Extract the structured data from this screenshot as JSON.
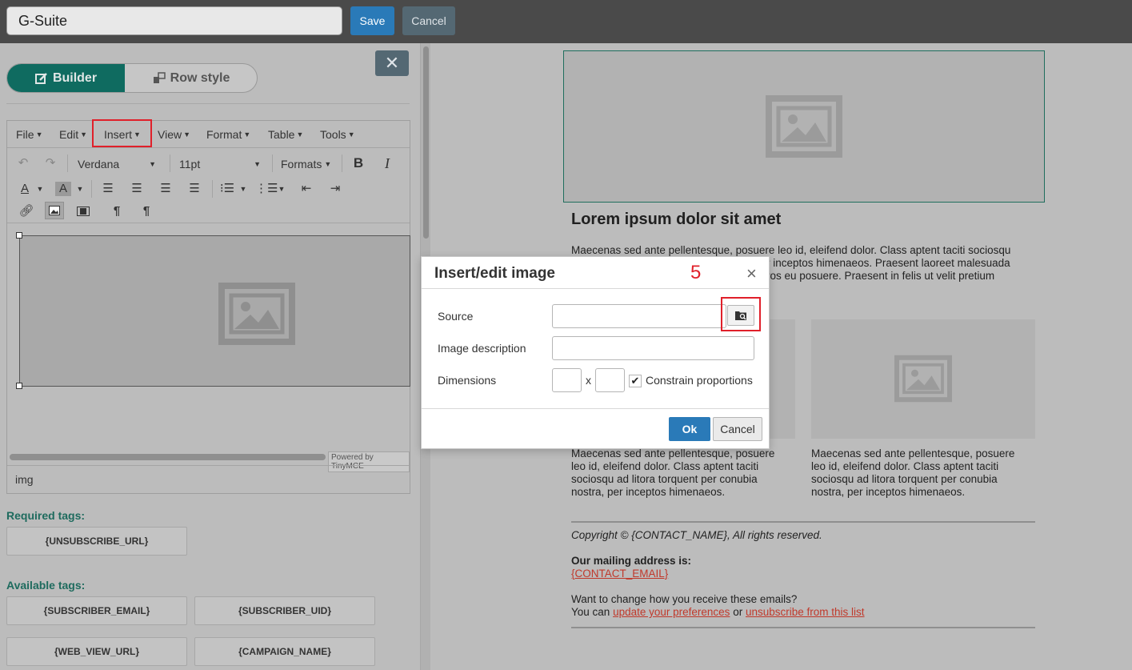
{
  "header": {
    "title_value": "G-Suite",
    "save_label": "Save",
    "cancel_label": "Cancel"
  },
  "left_panel": {
    "tabs": {
      "builder": "Builder",
      "row_style": "Row style"
    },
    "close_label": "✕"
  },
  "editor": {
    "menu": [
      "File",
      "Edit",
      "Insert",
      "View",
      "Format",
      "Table",
      "Tools"
    ],
    "font_family": "Verdana",
    "font_size": "11pt",
    "formats_label": "Formats",
    "powered_by": "Powered by TinyMCE",
    "status_path": "img"
  },
  "tags": {
    "required_label": "Required tags:",
    "required": [
      "{UNSUBSCRIBE_URL}"
    ],
    "available_label": "Available tags:",
    "available": [
      "{SUBSCRIBER_EMAIL}",
      "{SUBSCRIBER_UID}",
      "{WEB_VIEW_URL}",
      "{CAMPAIGN_NAME}"
    ]
  },
  "preview": {
    "heading": "Lorem ipsum dolor sit amet",
    "para1_lines": [
      "Maecenas sed ante pellentesque, posuere leo id, eleifend dolor. Class aptent taciti sociosqu",
      "r inceptos himenaeos. Praesent laoreet malesuada",
      "ros eu posuere. Praesent in felis ut velit pretium"
    ],
    "col1_lines": [
      "Maecenas sed ante pellentesque, posuere",
      "leo id, eleifend dolor. Class aptent taciti",
      "sociosqu ad litora torquent per conubia",
      "nostra, per inceptos himenaeos."
    ],
    "col2_lines": [
      "Maecenas sed ante pellentesque, posuere",
      "leo id, eleifend dolor. Class aptent taciti",
      "sociosqu ad litora torquent per conubia",
      "nostra, per inceptos himenaeos."
    ],
    "copyright": "Copyright © {CONTACT_NAME}, All rights reserved.",
    "mailing_label": "Our mailing address is:",
    "contact_email": "{CONTACT_EMAIL}",
    "change_text": "Want to change how you receive these emails?",
    "you_can": "You can",
    "update_link": "update your preferences",
    "or_text": "or",
    "unsubscribe_link": "unsubscribe from this list"
  },
  "dialog": {
    "title": "Insert/edit image",
    "step_marker": "5",
    "close_label": "×",
    "source_label": "Source",
    "source_value": "",
    "description_label": "Image description",
    "description_value": "",
    "dimensions_label": "Dimensions",
    "width_value": "",
    "height_value": "",
    "x_label": "x",
    "constrain_label": "Constrain proportions",
    "constrain_checked": true,
    "ok_label": "Ok",
    "cancel_label": "Cancel"
  },
  "colors": {
    "accent": "#0f6b60",
    "primary_button": "#2a7ab8",
    "highlight": "#e0202a",
    "link": "#c0392b"
  }
}
